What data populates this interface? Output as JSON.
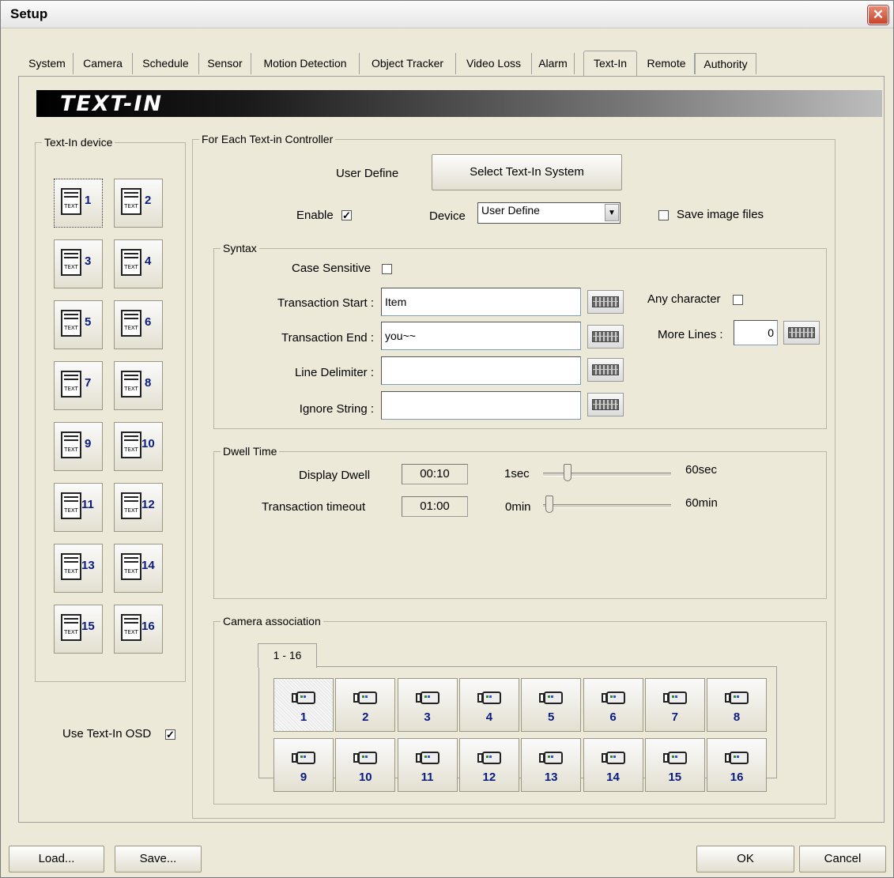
{
  "window": {
    "title": "Setup",
    "close_glyph": "✕"
  },
  "tabs": [
    "System",
    "Camera",
    "Schedule",
    "Sensor",
    "Motion Detection",
    "Object Tracker",
    "Video Loss",
    "Alarm",
    "Text-In",
    "Remote",
    "Authority"
  ],
  "active_tab": "Text-In",
  "banner": "TEXT-IN",
  "device_group": {
    "title": "Text-In device",
    "devices": [
      "1",
      "2",
      "3",
      "4",
      "5",
      "6",
      "7",
      "8",
      "9",
      "10",
      "11",
      "12",
      "13",
      "14",
      "15",
      "16"
    ],
    "selected": "1"
  },
  "use_osd": {
    "label": "Use Text-In OSD",
    "checked": true,
    "mark": "✓"
  },
  "controller": {
    "title": "For Each Text-in Controller",
    "user_define_label": "User Define",
    "select_button": "Select Text-In System",
    "enable_label": "Enable",
    "enable_mark": "✓",
    "device_label": "Device",
    "device_value": "User Define",
    "dropdown_glyph": "▼",
    "save_images_label": "Save image files"
  },
  "syntax": {
    "title": "Syntax",
    "case_sensitive": "Case Sensitive",
    "transaction_start_label": "Transaction Start :",
    "transaction_start_value": "Item",
    "transaction_end_label": "Transaction End :",
    "transaction_end_value": "you~~",
    "line_delimiter_label": "Line Delimiter :",
    "line_delimiter_value": "",
    "ignore_string_label": "Ignore String :",
    "ignore_string_value": "",
    "any_character": "Any character",
    "more_lines_label": "More Lines :",
    "more_lines_value": "0"
  },
  "dwell": {
    "title": "Dwell Time",
    "display_dwell_label": "Display Dwell",
    "display_dwell_value": "00:10",
    "display_min": "1sec",
    "display_max": "60sec",
    "display_level": 0.16,
    "transaction_timeout_label": "Transaction timeout",
    "transaction_timeout_value": "01:00",
    "timeout_min": "0min",
    "timeout_max": "60min",
    "timeout_level": 0.02
  },
  "camera_assoc": {
    "title": "Camera association",
    "tab": "1 - 16",
    "cameras": [
      "1",
      "2",
      "3",
      "4",
      "5",
      "6",
      "7",
      "8",
      "9",
      "10",
      "11",
      "12",
      "13",
      "14",
      "15",
      "16"
    ],
    "selected": "1"
  },
  "footer": {
    "load": "Load...",
    "save": "Save...",
    "ok": "OK",
    "cancel": "Cancel"
  }
}
